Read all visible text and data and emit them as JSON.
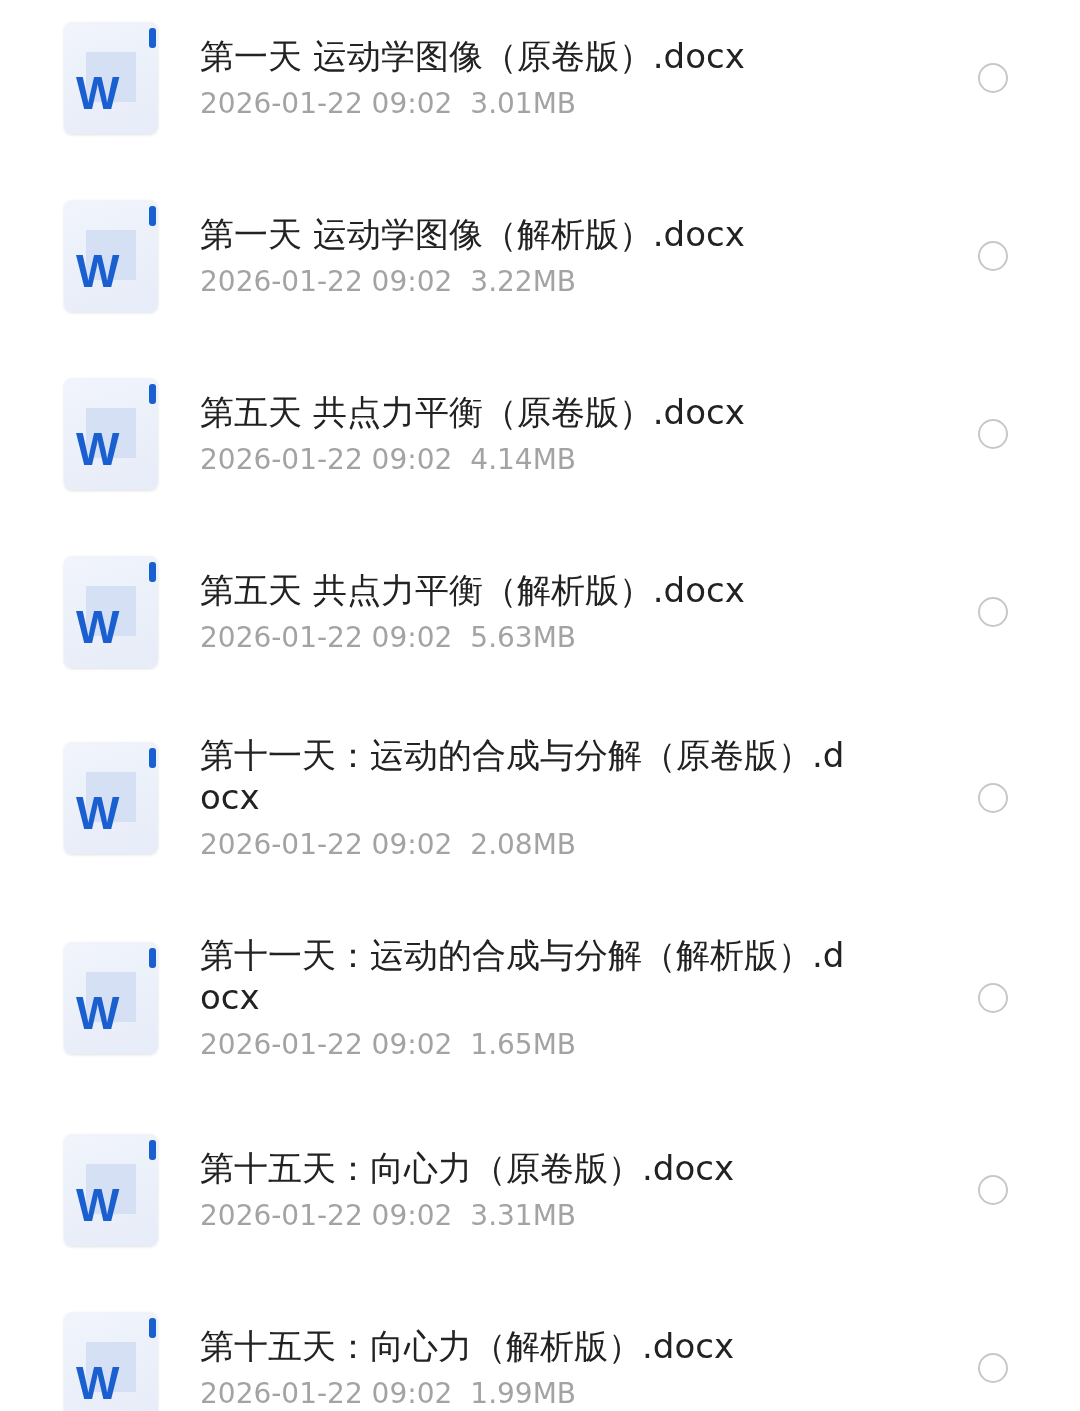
{
  "files": [
    {
      "icon_label": "W",
      "title": "第一天 运动学图像（原卷版）.docx",
      "date": "2026-01-22 09:02",
      "size": "3.01MB",
      "selected": false
    },
    {
      "icon_label": "W",
      "title": "第一天 运动学图像（解析版）.docx",
      "date": "2026-01-22 09:02",
      "size": "3.22MB",
      "selected": false
    },
    {
      "icon_label": "W",
      "title": "第五天 共点力平衡（原卷版）.docx",
      "date": "2026-01-22 09:02",
      "size": "4.14MB",
      "selected": false
    },
    {
      "icon_label": "W",
      "title": "第五天 共点力平衡（解析版）.docx",
      "date": "2026-01-22 09:02",
      "size": "5.63MB",
      "selected": false
    },
    {
      "icon_label": "W",
      "title": "第十一天：运动的合成与分解（原卷版）.docx",
      "date": "2026-01-22 09:02",
      "size": "2.08MB",
      "selected": false
    },
    {
      "icon_label": "W",
      "title": "第十一天：运动的合成与分解（解析版）.docx",
      "date": "2026-01-22 09:02",
      "size": "1.65MB",
      "selected": false
    },
    {
      "icon_label": "W",
      "title": "第十五天：向心力（原卷版）.docx",
      "date": "2026-01-22 09:02",
      "size": "3.31MB",
      "selected": false
    },
    {
      "icon_label": "W",
      "title": "第十五天：向心力（解析版）.docx",
      "date": "2026-01-22 09:02",
      "size": "1.99MB",
      "selected": false
    }
  ]
}
